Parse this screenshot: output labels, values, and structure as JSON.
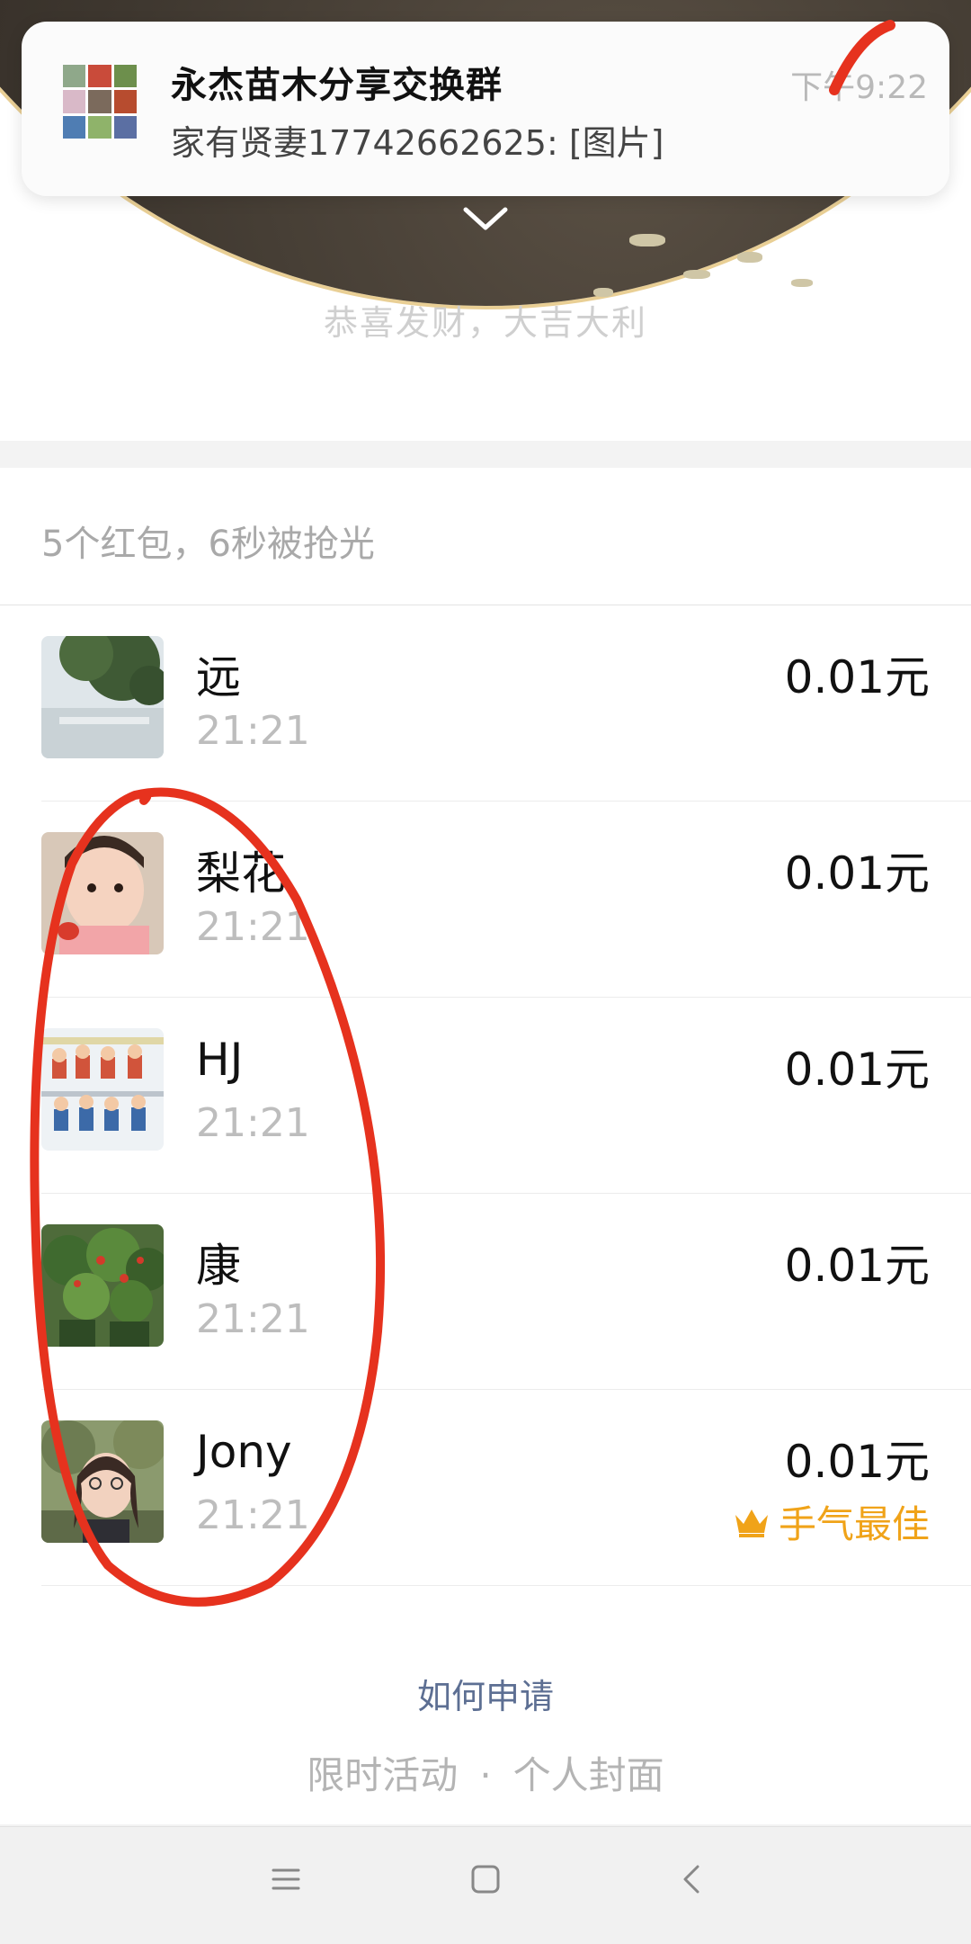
{
  "notification": {
    "title": "永杰苗木分享交换群",
    "message": "家有贤妻17742662625: [图片]",
    "time": "下午9:22"
  },
  "cover": {
    "blessing": "恭喜发财，大吉大利"
  },
  "packet": {
    "summary": "5个红包，6秒被抢光",
    "best_luck_label": "手气最佳",
    "records": [
      {
        "name": "远",
        "time": "21:21",
        "amount": "0.01元",
        "best": false,
        "avatar": "tree-photo"
      },
      {
        "name": "梨花",
        "time": "21:21",
        "amount": "0.01元",
        "best": false,
        "avatar": "child-photo"
      },
      {
        "name": "HJ",
        "time": "21:21",
        "amount": "0.01元",
        "best": false,
        "avatar": "cartoon-dolls"
      },
      {
        "name": "康",
        "time": "21:21",
        "amount": "0.01元",
        "best": false,
        "avatar": "potted-plants"
      },
      {
        "name": "Jony",
        "time": "21:21",
        "amount": "0.01元",
        "best": true,
        "avatar": "woman-portrait"
      }
    ]
  },
  "footer": {
    "how_to_apply": "如何申请",
    "link1": "限时活动",
    "separator": "·",
    "link2": "个人封面"
  },
  "colors": {
    "best_luck": "#f0a319",
    "link": "#5d6f93",
    "annotation": "#e6321e"
  }
}
